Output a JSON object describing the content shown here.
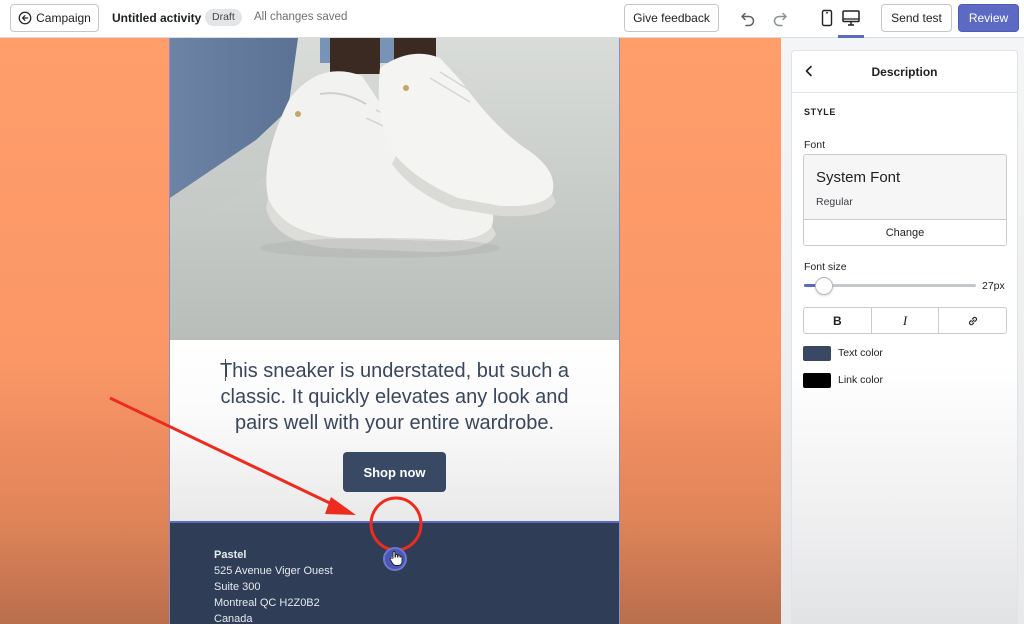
{
  "topbar": {
    "back_label": "Campaign",
    "title": "Untitled activity",
    "status_badge": "Draft",
    "save_status": "All changes saved",
    "feedback_label": "Give feedback",
    "send_test_label": "Send test",
    "review_label": "Review",
    "active_view": "desktop",
    "icons": [
      "arrow-left-circle-icon",
      "undo-icon",
      "redo-icon",
      "mobile-view-icon",
      "desktop-view-icon"
    ]
  },
  "email": {
    "image_alt_subject": "white sneakers on grey floor",
    "body_text": "This sneaker is understated, but such a classic. It quickly elevates any look and pairs well with your entire wardrobe.",
    "button_label": "Shop now",
    "footer": {
      "name": "Pastel",
      "address_line1": "525 Avenue Viger Ouest",
      "address_line2": "Suite 300",
      "city_line": "Montreal QC H2Z0B2",
      "country": "Canada"
    },
    "add_section_icon": "plus-icon"
  },
  "panel": {
    "title": "Description",
    "section_label": "STYLE",
    "font_label": "Font",
    "font_name": "System Font",
    "font_weight": "Regular",
    "change_label": "Change",
    "font_size_label": "Font size",
    "font_size_value": "27px",
    "font_size_fraction": 0.12,
    "format_buttons": {
      "bold": "B",
      "italic": "I",
      "link_icon": "link-icon"
    },
    "text_color_label": "Text color",
    "text_color": "#3a4963",
    "link_color_label": "Link color",
    "link_color": "#000000"
  },
  "colors": {
    "accent": "#5c6ac4",
    "canvas_bg": "#ff9d6b",
    "footer_bg": "#2f3e56",
    "annotation": "#ee2b1f"
  }
}
